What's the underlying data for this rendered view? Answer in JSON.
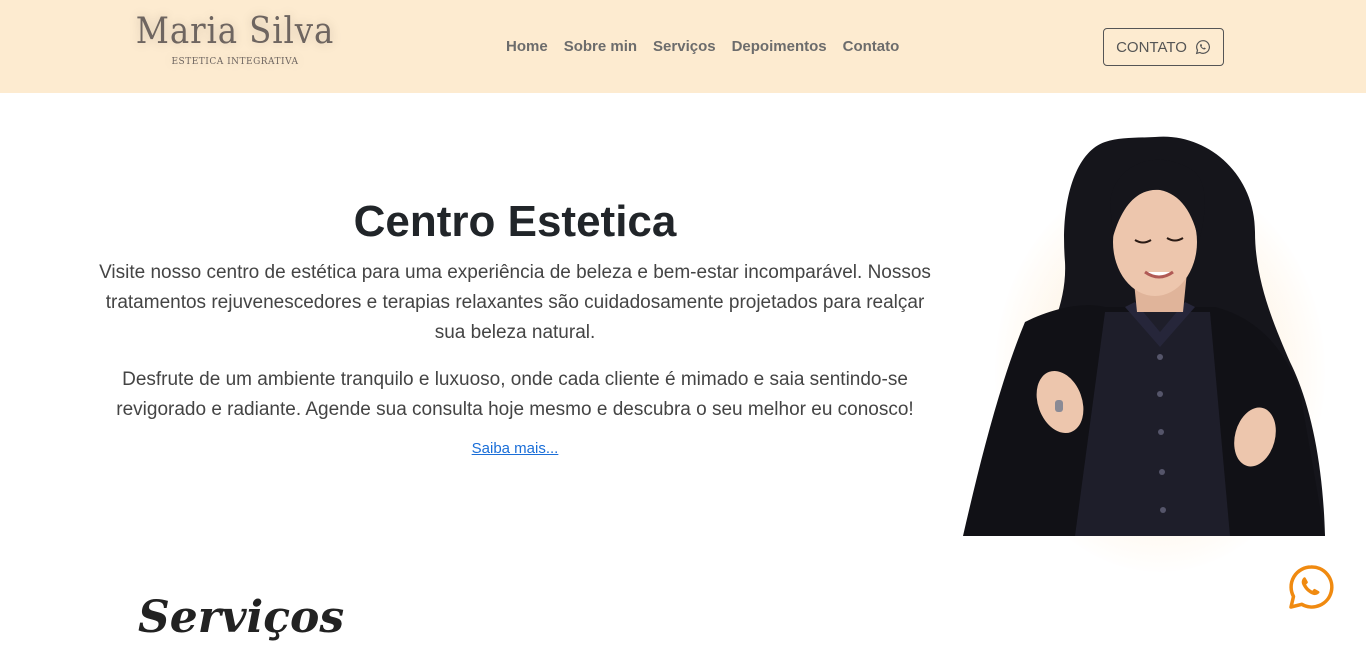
{
  "brand": {
    "name": "Maria Silva",
    "tagline": "ESTETICA INTEGRATIVA"
  },
  "nav": {
    "items": [
      "Home",
      "Sobre min",
      "Serviços",
      "Depoimentos",
      "Contato"
    ]
  },
  "header": {
    "contact_label": "CONTATO",
    "contact_icon": "whatsapp-icon"
  },
  "hero": {
    "title": "Centro Estetica",
    "paragraph1": "Visite nosso centro de estética para uma experiência de beleza e bem-estar incomparável. Nossos tratamentos rejuvenescedores e terapias relaxantes são cuidadosamente projetados para realçar sua beleza natural.",
    "paragraph2": "Desfrute de um ambiente tranquilo e luxuoso, onde cada cliente é mimado e saia sentindo-se revigorado e radiante. Agende sua consulta hoje mesmo e descubra o seu melhor eu conosco!",
    "link_label": "Saiba mais..."
  },
  "services": {
    "title": "Serviços"
  },
  "colors": {
    "header_bg": "#fdebd0",
    "link": "#1a6ed8",
    "whatsapp_accent": "#f08a10"
  }
}
